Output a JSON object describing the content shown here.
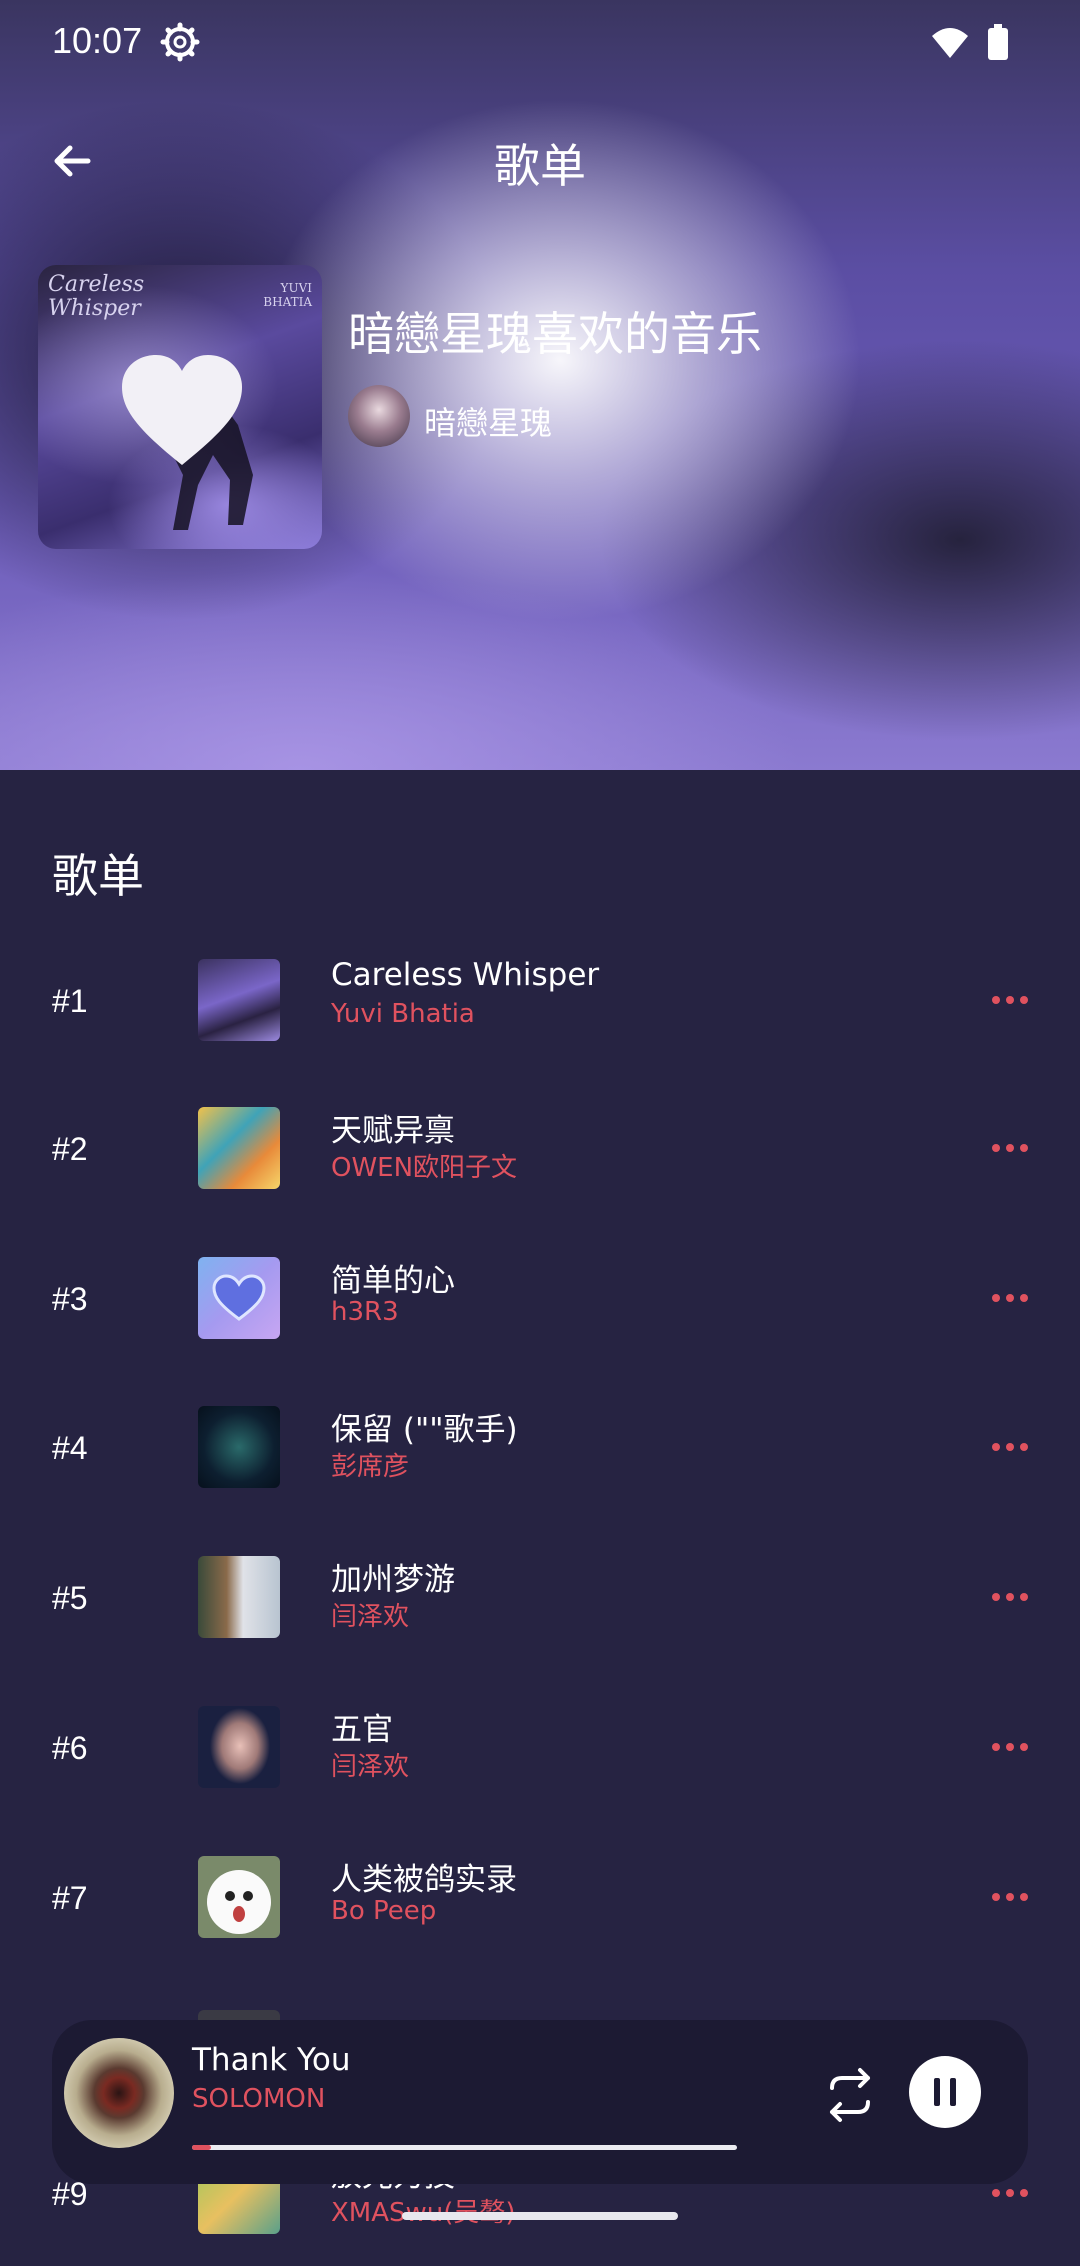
{
  "status_bar": {
    "time": "10:07"
  },
  "header": {
    "title": "歌单",
    "back_icon": "arrow-left-icon"
  },
  "playlist": {
    "name": "暗戀星瑰喜欢的音乐",
    "owner": "暗戀星瑰",
    "cover": {
      "script_text": "Careless Whisper",
      "artist_text": "YUVI BHATIA",
      "badge_icon": "heart-icon"
    }
  },
  "section": {
    "title": "歌单"
  },
  "songs": [
    {
      "rank": "#1",
      "title": "Careless Whisper",
      "artist": "Yuvi Bhatia"
    },
    {
      "rank": "#2",
      "title": "天赋异禀",
      "artist": "OWEN欧阳子文"
    },
    {
      "rank": "#3",
      "title": "简单的心",
      "artist": "h3R3"
    },
    {
      "rank": "#4",
      "title": "保留 (\"\"歌手)",
      "artist": "彭席彦"
    },
    {
      "rank": "#5",
      "title": "加州梦游",
      "artist": "闫泽欢"
    },
    {
      "rank": "#6",
      "title": "五官",
      "artist": "闫泽欢"
    },
    {
      "rank": "#7",
      "title": "人类被鸽实录",
      "artist": "Bo Peep"
    },
    {
      "rank": "#9",
      "title": "放光力技",
      "artist": "XMASwu(吴骜)"
    }
  ],
  "now_playing": {
    "title": "Thank You",
    "artist": "SOLOMON",
    "progress": 0.035,
    "repeat_icon": "repeat-icon",
    "pause_icon": "pause-icon"
  },
  "colors": {
    "accent": "#e0525f",
    "background": "#262342",
    "player_bg": "#1c1a33"
  }
}
